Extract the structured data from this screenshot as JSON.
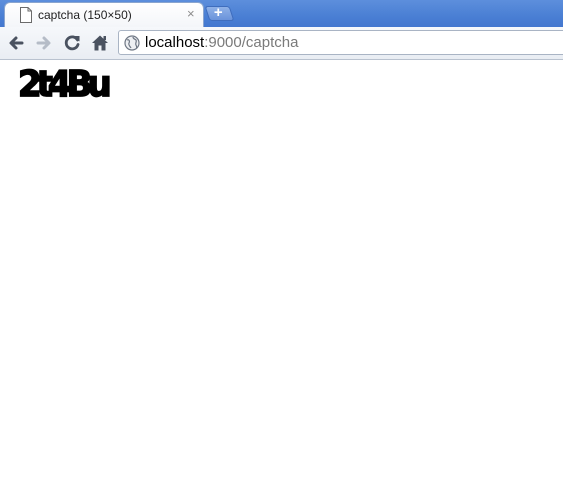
{
  "tab": {
    "title": "captcha (150×50)",
    "close_glyph": "×",
    "favicon_icon": "document-icon"
  },
  "newtab": {
    "glyph": "+"
  },
  "toolbar": {
    "back_icon": "back-arrow-icon",
    "forward_icon": "forward-arrow-icon",
    "reload_icon": "reload-icon",
    "home_icon": "home-icon"
  },
  "omnibox": {
    "icon": "globe-icon",
    "host": "localhost",
    "path": ":9000/captcha"
  },
  "page": {
    "captcha_text": "2t4Bu"
  }
}
